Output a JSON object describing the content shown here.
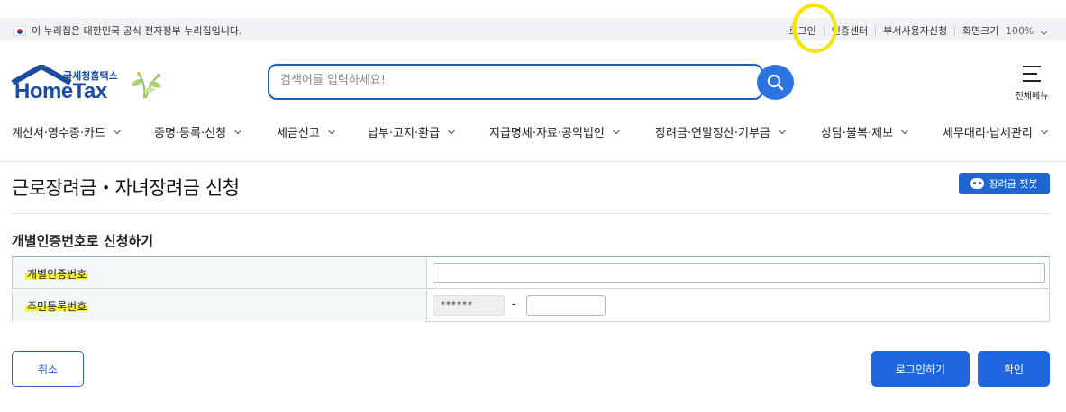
{
  "gov_bar": {
    "notice": "이 누리집은 대한민국 공식 전자정부 누리집입니다.",
    "links": [
      "로그인",
      "인증센터",
      "부서사용자신청"
    ],
    "zoom_label": "화면크기",
    "zoom_value": "100%"
  },
  "header": {
    "logo_small": "국세청홈택스",
    "logo_brand": "HomeTax",
    "search_placeholder": "검색어를 입력하세요!",
    "menu_label": "전체메뉴"
  },
  "gnb": {
    "items": [
      "계산서·영수증·카드",
      "증명·등록·신청",
      "세금신고",
      "납부·고지·환급",
      "지급명세·자료·공익법인",
      "장려금·연말정산·기부금",
      "상담·불복·제보",
      "세무대리·납세관리"
    ]
  },
  "page": {
    "title": "근로장려금・자녀장려금 신청",
    "chatbot_label": "장려금 챗봇",
    "section_title": "개별인증번호로 신청하기"
  },
  "form": {
    "auth_number_label": "개별인증번호",
    "resident_number_label": "주민등록번호",
    "resident_front_masked": "******",
    "dash": "-"
  },
  "buttons": {
    "cancel": "취소",
    "login": "로그인하기",
    "confirm": "확인"
  },
  "colors": {
    "primary": "#1f66de",
    "annotation": "#f5e60a",
    "table_header_bg": "#f1f8f7"
  }
}
